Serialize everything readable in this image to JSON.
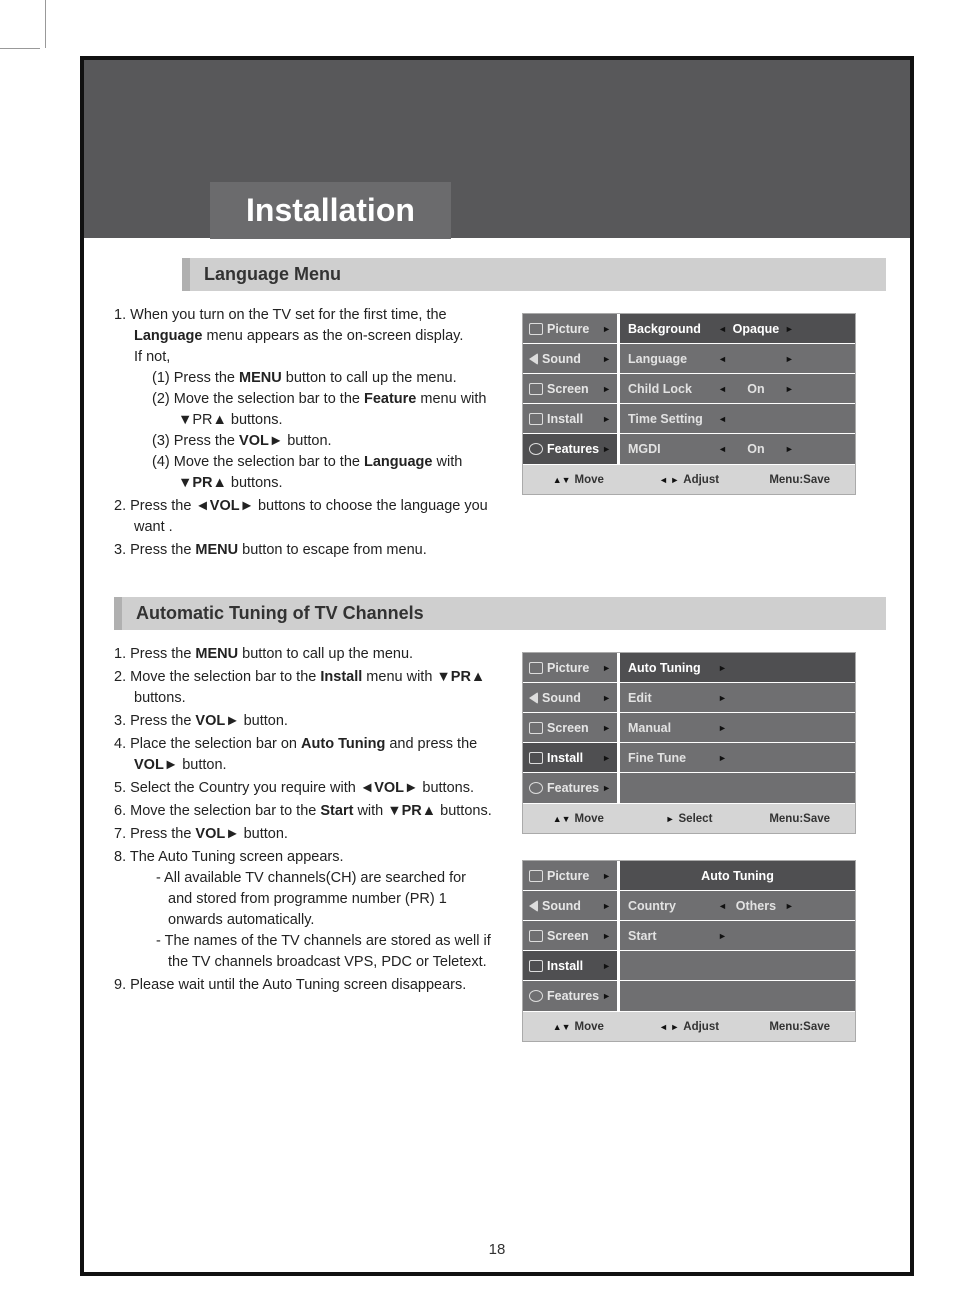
{
  "page_title": "Installation",
  "page_number": "18",
  "section1": {
    "heading": "Language Menu",
    "p1a": "When you turn on the TV set for the first time, the ",
    "p1b": "Language",
    "p1c": " menu appears as the on-screen display.",
    "ifnot": "If not,",
    "s1a": "(1) Press the ",
    "s1b": "MENU",
    "s1c": " button to call up the menu.",
    "s2a": "(2) Move the selection bar to the ",
    "s2b": "Feature",
    "s2c": " menu with  ▼PR▲ buttons.",
    "s3a": "(3) Press the ",
    "s3b": "VOL►",
    "s3c": " button.",
    "s4a": "(4) Move the selection bar to the ",
    "s4b": "Language",
    "s4c": " with  ▼",
    "s4d": "PR▲",
    "s4e": " buttons.",
    "p2a": "Press the  ◄",
    "p2b": "VOL►",
    "p2c": "  buttons to choose the language you want .",
    "p3a": "Press the ",
    "p3b": "MENU",
    "p3c": " button to escape from menu."
  },
  "section2": {
    "heading": "Automatic Tuning of TV Channels",
    "l1a": "Press the ",
    "l1b": "MENU",
    "l1c": " button to call up the menu.",
    "l2a": "Move the selection bar to the ",
    "l2b": "Install",
    "l2c": " menu with ▼",
    "l2d": "PR▲",
    "l2e": " buttons.",
    "l3a": "Press the ",
    "l3b": "VOL►",
    "l3c": " button.",
    "l4a": "Place the selection bar on ",
    "l4b": "Auto Tuning",
    "l4c": " and press the ",
    "l4d": "VOL►",
    "l4e": " button.",
    "l5a": "Select the Country you require with  ◄",
    "l5b": "VOL►",
    "l5c": " buttons.",
    "l6a": "Move the selection bar to the ",
    "l6b": "Start",
    "l6c": " with ▼",
    "l6d": "PR▲",
    "l6e": " buttons.",
    "l7a": "Press the ",
    "l7b": "VOL►",
    "l7c": " button.",
    "l8": "The Auto Tuning screen appears.",
    "l8s1": "- All available TV channels(CH) are searched for and stored from programme number (PR) 1 onwards automatically.",
    "l8s2": "- The names of the TV channels are stored as well if the TV channels broadcast VPS, PDC or Teletext.",
    "l9": "Please wait until the Auto Tuning screen disappears."
  },
  "osd_nav": {
    "picture": "Picture",
    "sound": "Sound",
    "screen": "Screen",
    "install": "Install",
    "features": "Features"
  },
  "osd1": {
    "r1_label": "Background",
    "r1_val": "Opaque",
    "r2_label": "Language",
    "r3_label": "Child Lock",
    "r3_val": "On",
    "r4_label": "Time Setting",
    "r5_label": "MGDI",
    "r5_val": "On"
  },
  "osd2": {
    "r1": "Auto Tuning",
    "r2": "Edit",
    "r3": "Manual",
    "r4": "Fine Tune"
  },
  "osd3": {
    "title": "Auto Tuning",
    "r1_label": "Country",
    "r1_val": "Others",
    "r2_label": "Start"
  },
  "footer": {
    "move": "Move",
    "adjust": "Adjust",
    "select": "Select",
    "menu_save": "Menu:Save"
  }
}
